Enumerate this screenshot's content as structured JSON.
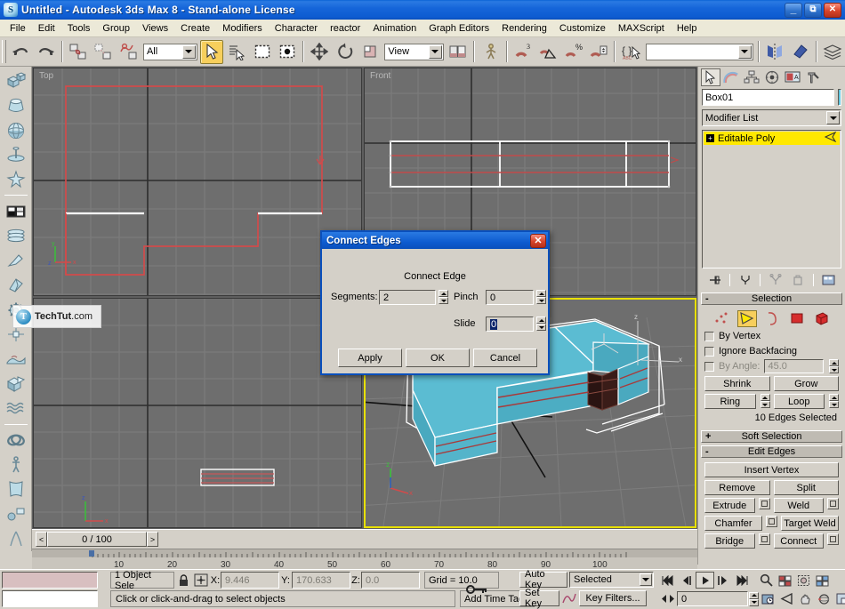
{
  "window": {
    "title": "Untitled - Autodesk 3ds Max 8  - Stand-alone License",
    "app_icon": "max-logo-icon",
    "minimize": "_",
    "maximize": "❐",
    "close": "✕"
  },
  "menu": {
    "items": [
      {
        "label": "File"
      },
      {
        "label": "Edit"
      },
      {
        "label": "Tools"
      },
      {
        "label": "Group"
      },
      {
        "label": "Views"
      },
      {
        "label": "Create"
      },
      {
        "label": "Modifiers"
      },
      {
        "label": "Character"
      },
      {
        "label": "reactor"
      },
      {
        "label": "Animation"
      },
      {
        "label": "Graph Editors"
      },
      {
        "label": "Rendering"
      },
      {
        "label": "Customize"
      },
      {
        "label": "MAXScript"
      },
      {
        "label": "Help"
      }
    ]
  },
  "toolbar": {
    "undo": "undo-icon",
    "redo": "redo-icon",
    "select_link": "select-and-link-icon",
    "unlink": "unlink-selection-icon",
    "bind_space_warp": "bind-to-space-warp-icon",
    "selection_filter_value": "All",
    "select_object": "select-object-icon",
    "select_by_name": "select-by-name-icon",
    "rectangular_region": "rectangular-selection-region-icon",
    "window_crossing": "window-crossing-icon",
    "select_move": "select-and-move-icon",
    "select_rotate": "select-and-rotate-icon",
    "select_scale": "select-and-uniform-scale-icon",
    "reference_coord_value": "View",
    "use_center": "use-pivot-point-center-icon",
    "select_manipulate": "select-and-manipulate-icon",
    "snap_toggle": "snaps-toggle-3d-icon",
    "angle_snap": "angle-snap-toggle-icon",
    "percent_snap": "percent-snap-toggle-icon",
    "spinner_snap": "spinner-snap-toggle-icon",
    "named_selection_sets_value": "",
    "mirror": "mirror-icon",
    "align": "align-icon",
    "layer_manager": "layer-manager-icon"
  },
  "left_toolbar": {
    "items": [
      {
        "name": "box-primitive-icon"
      },
      {
        "name": "extended-primitive-icon"
      },
      {
        "name": "sphere-primitive-icon"
      },
      {
        "name": "lathe-icon"
      },
      {
        "name": "biped-icon"
      },
      {
        "name": "material-editor-icon"
      },
      {
        "name": "loft-icon"
      },
      {
        "name": "taper-icon"
      },
      {
        "name": "bevel-icon"
      },
      {
        "name": "settings-gear-icon"
      },
      {
        "name": "hierarchy-pivot-icon"
      },
      {
        "name": "landscape-icon"
      },
      {
        "name": "boolean-icon"
      },
      {
        "name": "noise-modifier-icon"
      },
      {
        "name": "torus-knot-icon"
      },
      {
        "name": "skeleton-rig-icon"
      },
      {
        "name": "cloth-icon"
      },
      {
        "name": "helpers-icon"
      },
      {
        "name": "particle-icon"
      }
    ]
  },
  "viewports": [
    {
      "name": "viewport-top",
      "label": "Top",
      "active": false
    },
    {
      "name": "viewport-front",
      "label": "Front",
      "active": false
    },
    {
      "name": "viewport-left",
      "label": "",
      "active": false
    },
    {
      "name": "viewport-perspective",
      "label": "",
      "active": true
    }
  ],
  "time_slider": {
    "prev_label": "<",
    "value": "0 / 100",
    "next_label": ">"
  },
  "ruler": {
    "ticks": [
      "10",
      "20",
      "30",
      "40",
      "50",
      "60",
      "70",
      "80",
      "90",
      "100"
    ]
  },
  "command_panel": {
    "tabs": [
      {
        "name": "create-tab",
        "icon": "arrow-cursor-icon",
        "selected": true
      },
      {
        "name": "modify-tab",
        "icon": "rainbow-arc-icon",
        "selected": false
      },
      {
        "name": "hierarchy-tab",
        "icon": "hierarchy-tree-icon",
        "selected": false
      },
      {
        "name": "motion-tab",
        "icon": "wheel-icon",
        "selected": false
      },
      {
        "name": "display-tab",
        "icon": "monitor-icon",
        "selected": false
      },
      {
        "name": "utilities-tab",
        "icon": "hammer-icon",
        "selected": false
      }
    ],
    "object_name": "Box01",
    "object_color": "#63c7e0",
    "modifier_list_label": "Modifier List",
    "stack": [
      {
        "label": "Editable Poly",
        "selected": true
      }
    ],
    "stack_buttons": [
      {
        "name": "pin-stack-icon"
      },
      {
        "name": "show-end-result-icon"
      },
      {
        "name": "make-unique-icon"
      },
      {
        "name": "remove-modifier-icon"
      },
      {
        "name": "configure-modifier-sets-icon"
      }
    ],
    "selection_rollout": {
      "title": "Selection",
      "expander": "-",
      "sublevels": [
        {
          "name": "vertex-sublevel-icon",
          "selected": false
        },
        {
          "name": "edge-sublevel-icon",
          "selected": true
        },
        {
          "name": "border-sublevel-icon",
          "selected": false
        },
        {
          "name": "polygon-sublevel-icon",
          "selected": false
        },
        {
          "name": "element-sublevel-icon",
          "selected": false
        }
      ],
      "by_vertex_label": "By Vertex",
      "by_vertex_checked": false,
      "ignore_backfacing_label": "Ignore Backfacing",
      "ignore_backfacing_checked": false,
      "by_angle_label": "By Angle:",
      "by_angle_checked": false,
      "by_angle_value": "45.0",
      "shrink_label": "Shrink",
      "grow_label": "Grow",
      "ring_label": "Ring",
      "loop_label": "Loop",
      "status": "10 Edges Selected"
    },
    "soft_selection_rollout": {
      "title": "Soft Selection",
      "expander": "+"
    },
    "edit_edges_rollout": {
      "title": "Edit Edges",
      "expander": "-",
      "insert_vertex_label": "Insert Vertex",
      "remove_label": "Remove",
      "split_label": "Split",
      "extrude_label": "Extrude",
      "weld_label": "Weld",
      "chamfer_label": "Chamfer",
      "target_weld_label": "Target Weld",
      "bridge_label": "Bridge",
      "connect_label": "Connect"
    }
  },
  "dialog": {
    "title": "Connect Edges",
    "close_label": "✕",
    "group_label": "Connect Edge",
    "segments_label": "Segments:",
    "segments_value": "2",
    "pinch_label": "Pinch",
    "pinch_value": "0",
    "slide_label": "Slide",
    "slide_value": "0",
    "apply_label": "Apply",
    "ok_label": "OK",
    "cancel_label": "Cancel"
  },
  "status_bar": {
    "selection_count": "1 Object Sele",
    "lock_icon": "lock-selection-icon",
    "transform_icon": "transform-type-in-icon",
    "x_label": "X:",
    "x_value": "9.446",
    "y_label": "Y:",
    "y_value": "170.633",
    "z_label": "Z:",
    "z_value": "0.0",
    "grid_label": "Grid = 10.0",
    "prompt": "Click or click-and-drag to select objects",
    "add_time_tag": "Add Time Tag",
    "key_mode_icon": "key-mode-toggle-icon"
  },
  "animation": {
    "auto_key_label": "Auto Key",
    "set_key_label": "Set Key",
    "filter_value": "Selected",
    "key_filters_label": "Key Filters...",
    "curve_editor_icon": "set-key-curve-icon",
    "frame_value": "0",
    "transport": [
      {
        "name": "go-to-start-button",
        "glyph": "⏮"
      },
      {
        "name": "previous-frame-button",
        "glyph": "◂|"
      },
      {
        "name": "play-animation-button",
        "glyph": "▶"
      },
      {
        "name": "next-frame-button",
        "glyph": "|▸"
      },
      {
        "name": "go-to-end-button",
        "glyph": "⏭"
      }
    ],
    "key_mode_label": "◂▸",
    "time_config_icon": "time-configuration-icon",
    "nav": [
      {
        "name": "zoom-button",
        "glyph": "zoom-icon"
      },
      {
        "name": "zoom-all-button",
        "glyph": "zoom-all-icon"
      },
      {
        "name": "zoom-extents-button",
        "glyph": "zoom-extents-icon"
      },
      {
        "name": "zoom-region-button",
        "glyph": "zoom-region-icon"
      },
      {
        "name": "field-of-view-button",
        "glyph": "field-of-view-icon"
      },
      {
        "name": "pan-button",
        "glyph": "pan-hand-icon"
      },
      {
        "name": "arc-rotate-button",
        "glyph": "arc-rotate-icon"
      },
      {
        "name": "maximize-viewport-button",
        "glyph": "maximize-viewport-icon"
      }
    ]
  },
  "watermark": {
    "badge": "T",
    "name": "TechTut",
    "suffix": ".com"
  }
}
